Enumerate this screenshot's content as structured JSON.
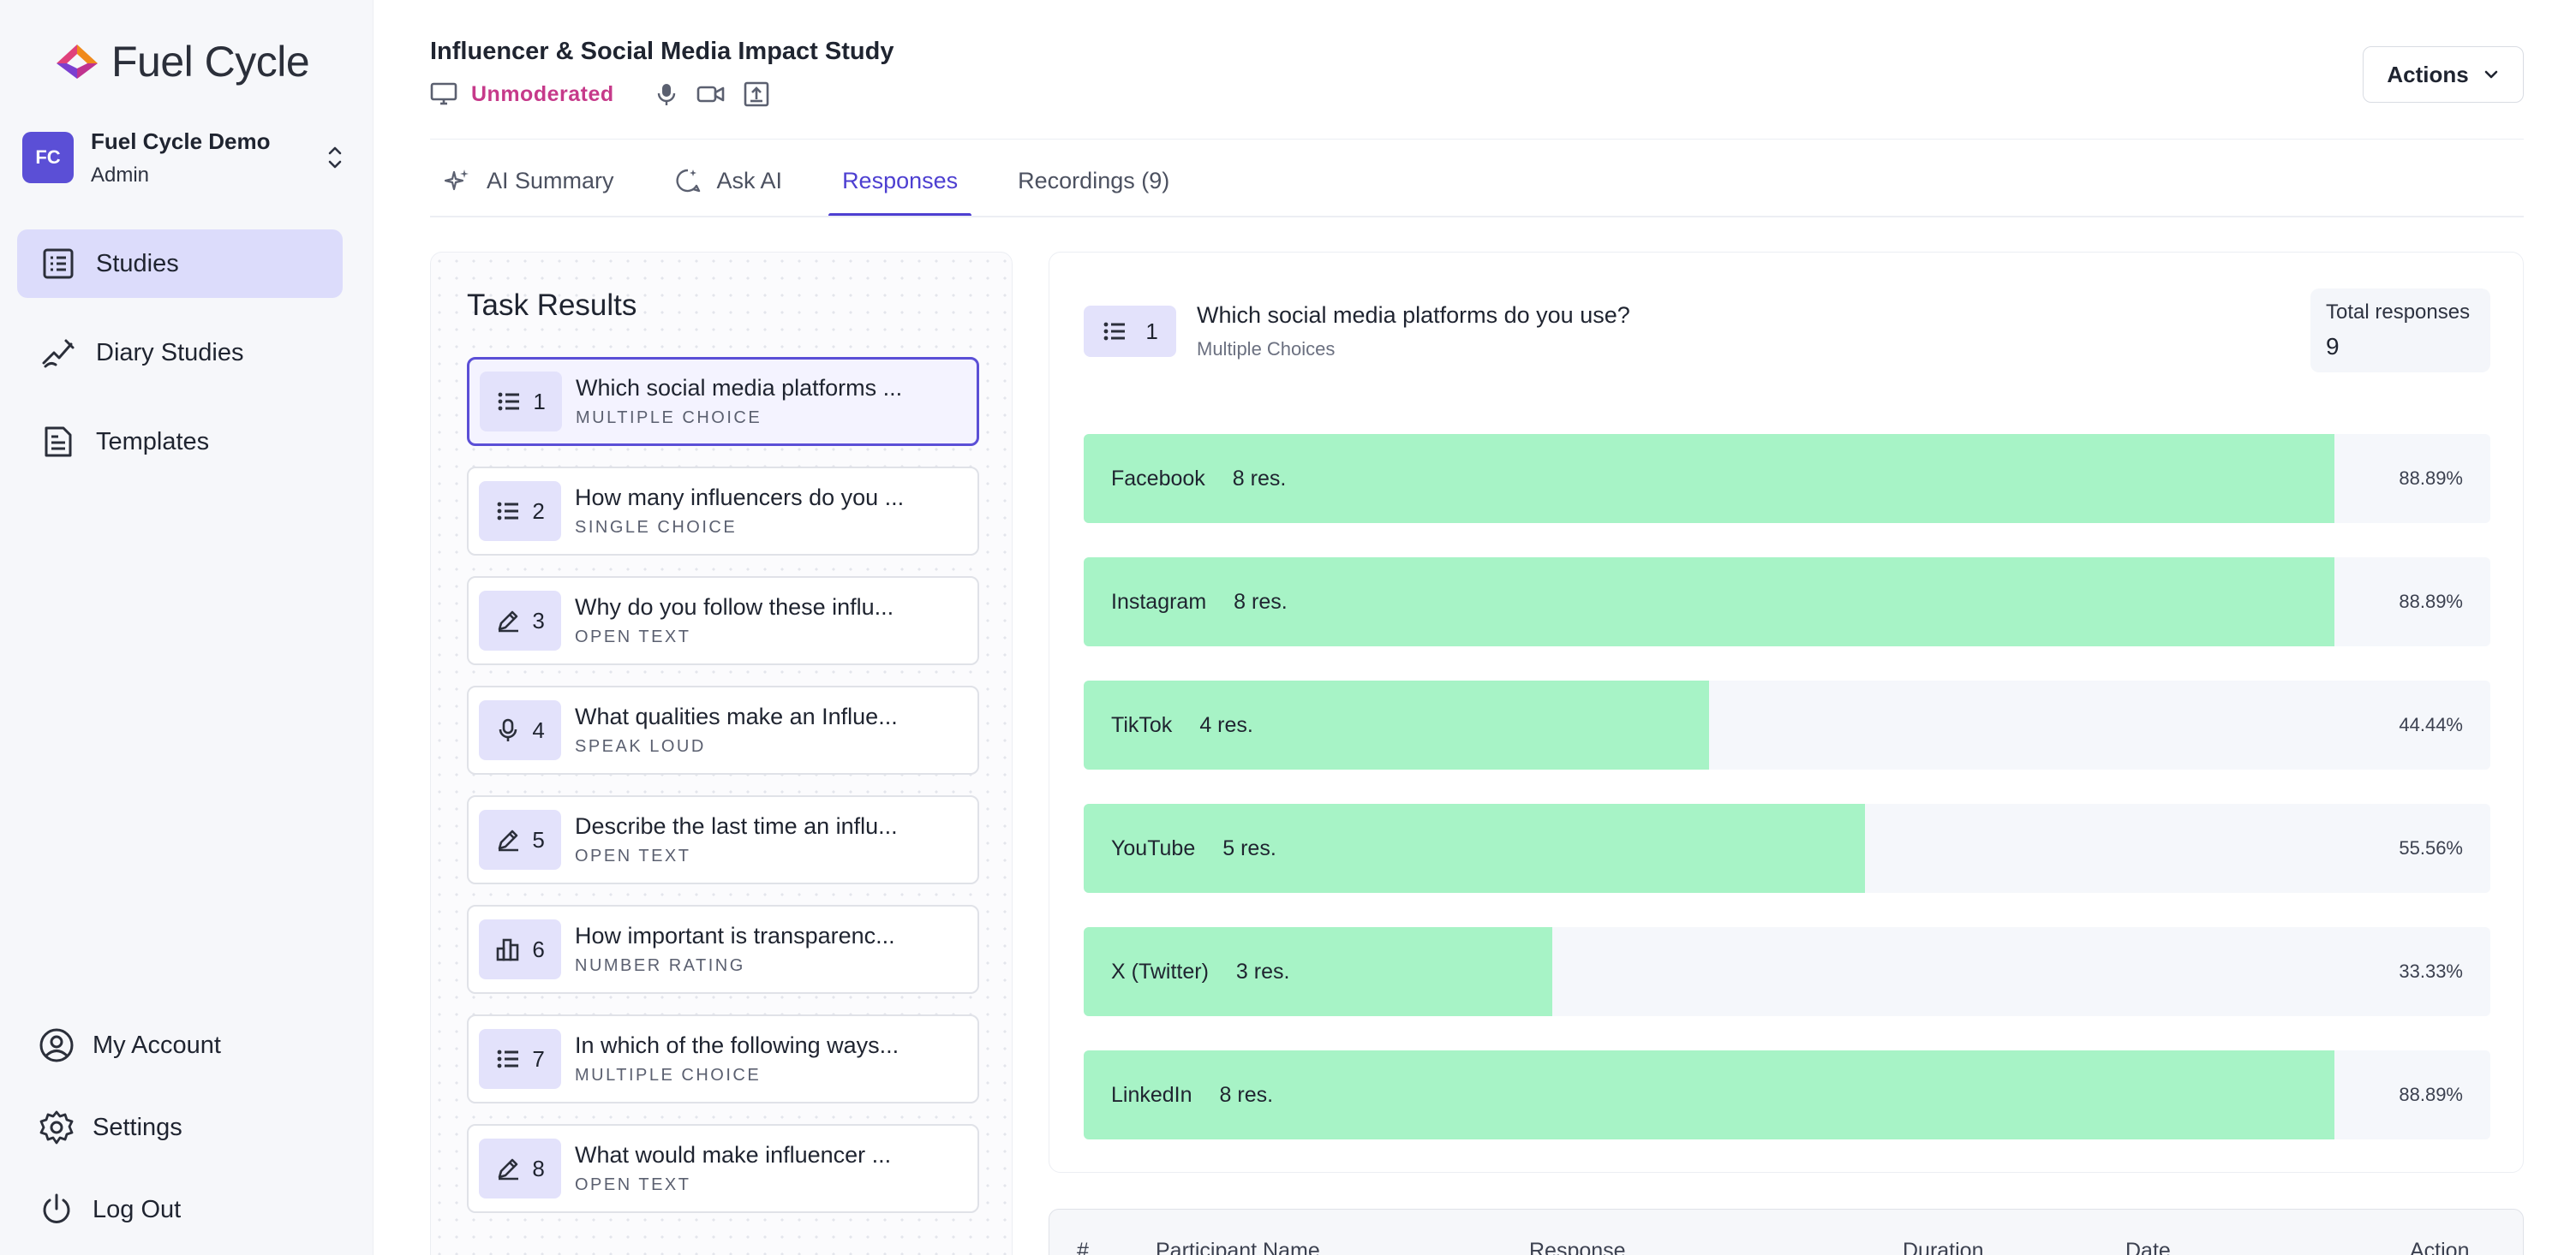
{
  "brand": {
    "name": "Fuel Cycle",
    "accent": "#5b4fd6",
    "bar_color": "#a7f3c6"
  },
  "org": {
    "initials": "FC",
    "name": "Fuel Cycle Demo",
    "role": "Admin"
  },
  "nav": [
    {
      "label": "Studies",
      "icon": "studies-icon",
      "active": true
    },
    {
      "label": "Diary Studies",
      "icon": "diary-icon",
      "active": false
    },
    {
      "label": "Templates",
      "icon": "templates-icon",
      "active": false
    }
  ],
  "bottom_nav": [
    {
      "label": "My Account",
      "icon": "user-circle-icon"
    },
    {
      "label": "Settings",
      "icon": "gear-icon"
    },
    {
      "label": "Log Out",
      "icon": "power-icon"
    }
  ],
  "study": {
    "title": "Influencer & Social Media Impact Study",
    "status": "Unmoderated"
  },
  "actions_label": "Actions",
  "tabs": [
    {
      "label": "AI Summary",
      "icon": "sparkle-icon",
      "active": false
    },
    {
      "label": "Ask AI",
      "icon": "chat-ai-icon",
      "active": false
    },
    {
      "label": "Responses",
      "icon": "",
      "active": true
    },
    {
      "label": "Recordings (9)",
      "icon": "",
      "active": false
    }
  ],
  "task_results": {
    "heading": "Task Results",
    "items": [
      {
        "num": "1",
        "title": "Which social media platforms ...",
        "type": "MULTIPLE CHOICE",
        "icon": "list-icon",
        "active": true
      },
      {
        "num": "2",
        "title": "How many influencers do you ...",
        "type": "SINGLE CHOICE",
        "icon": "list-icon",
        "active": false
      },
      {
        "num": "3",
        "title": "Why do you follow these influ...",
        "type": "OPEN TEXT",
        "icon": "pen-icon",
        "active": false
      },
      {
        "num": "4",
        "title": "What qualities make an Influe...",
        "type": "SPEAK LOUD",
        "icon": "mic-icon",
        "active": false
      },
      {
        "num": "5",
        "title": "Describe the last time an influ...",
        "type": "OPEN TEXT",
        "icon": "pen-icon",
        "active": false
      },
      {
        "num": "6",
        "title": "How important is transparenc...",
        "type": "NUMBER RATING",
        "icon": "rating-icon",
        "active": false
      },
      {
        "num": "7",
        "title": "In which of the following ways...",
        "type": "MULTIPLE CHOICE",
        "icon": "list-icon",
        "active": false
      },
      {
        "num": "8",
        "title": "What would make influencer ...",
        "type": "OPEN TEXT",
        "icon": "pen-icon",
        "active": false
      }
    ]
  },
  "question": {
    "num": "1",
    "title": "Which social media platforms do you use?",
    "type": "Multiple Choices",
    "total_label": "Total responses",
    "total_value": "9"
  },
  "chart_data": {
    "type": "bar",
    "orientation": "horizontal",
    "categories": [
      "Facebook",
      "Instagram",
      "TikTok",
      "YouTube",
      "X (Twitter)",
      "LinkedIn"
    ],
    "counts": [
      "8 res.",
      "8 res.",
      "4 res.",
      "5 res.",
      "3 res.",
      "8 res."
    ],
    "values": [
      88.89,
      88.89,
      44.44,
      55.56,
      33.33,
      88.89
    ],
    "value_labels": [
      "88.89%",
      "88.89%",
      "44.44%",
      "55.56%",
      "33.33%",
      "88.89%"
    ],
    "xlim": [
      0,
      100
    ]
  },
  "table": {
    "columns": [
      "#",
      "Participant Name",
      "Response",
      "Duration",
      "Date",
      "Action"
    ]
  }
}
